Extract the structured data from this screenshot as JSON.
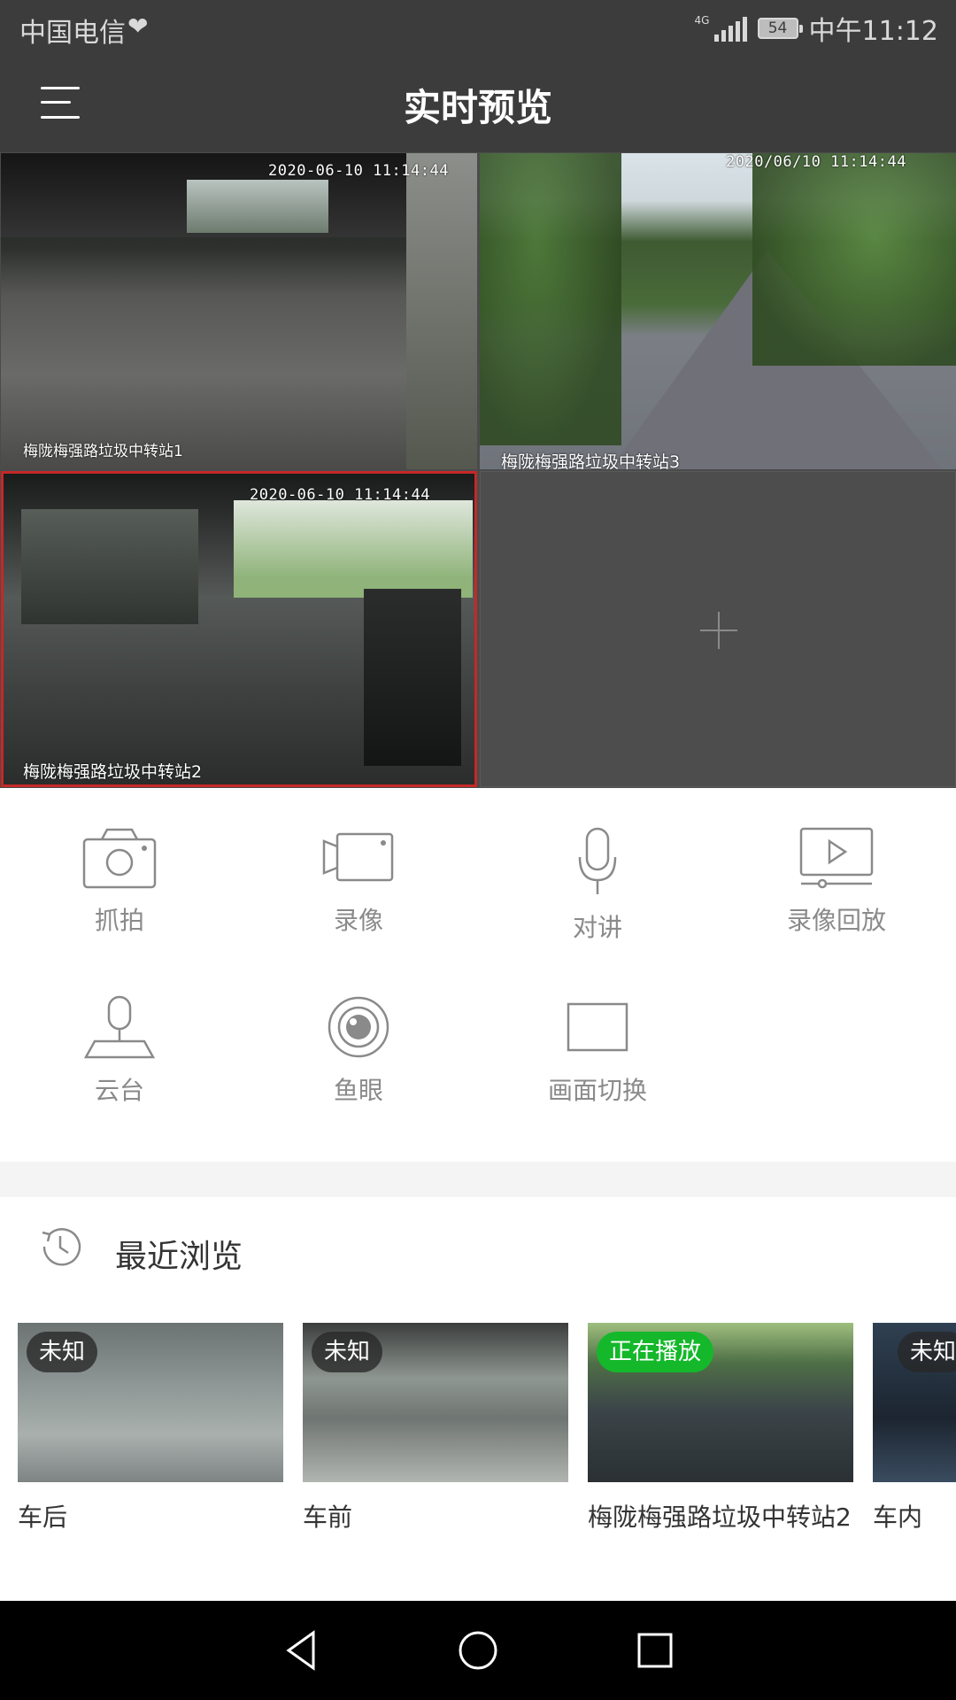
{
  "status_bar": {
    "carrier": "中国电信",
    "network": "4G",
    "battery": "54",
    "time": "中午11:12"
  },
  "header": {
    "title": "实时预览"
  },
  "video_grid": [
    {
      "timestamp": "2020-06-10 11:14:44",
      "camera_name": "梅陇梅强路垃圾中转站1",
      "selected": false
    },
    {
      "timestamp": "2020/06/10 11:14:44",
      "camera_name": "梅陇梅强路垃圾中转站3",
      "selected": false
    },
    {
      "timestamp": "2020-06-10 11:14:44",
      "camera_name": "梅陇梅强路垃圾中转站2",
      "selected": true
    },
    {
      "empty": true,
      "icon": "plus-icon"
    }
  ],
  "controls": {
    "row1": [
      {
        "label": "抓拍",
        "icon": "camera-icon"
      },
      {
        "label": "录像",
        "icon": "video-camera-icon"
      },
      {
        "label": "对讲",
        "icon": "microphone-icon"
      },
      {
        "label": "录像回放",
        "icon": "playback-icon"
      }
    ],
    "row2": [
      {
        "label": "云台",
        "icon": "ptz-icon"
      },
      {
        "label": "鱼眼",
        "icon": "fisheye-icon"
      },
      {
        "label": "画面切换",
        "icon": "screen-switch-icon"
      }
    ]
  },
  "recent": {
    "title": "最近浏览",
    "icon": "history-clock-icon",
    "items": [
      {
        "name": "车后",
        "status": "未知"
      },
      {
        "name": "车前",
        "status": "未知"
      },
      {
        "name": "梅陇梅强路垃圾中转站2",
        "status": "正在播放"
      },
      {
        "name": "车内",
        "status": "未知"
      }
    ]
  },
  "colors": {
    "header_bg": "#3c3c3c",
    "selected_border": "#c62828",
    "playing_badge": "#14b82a",
    "icon_gray": "#8a8a8a"
  }
}
